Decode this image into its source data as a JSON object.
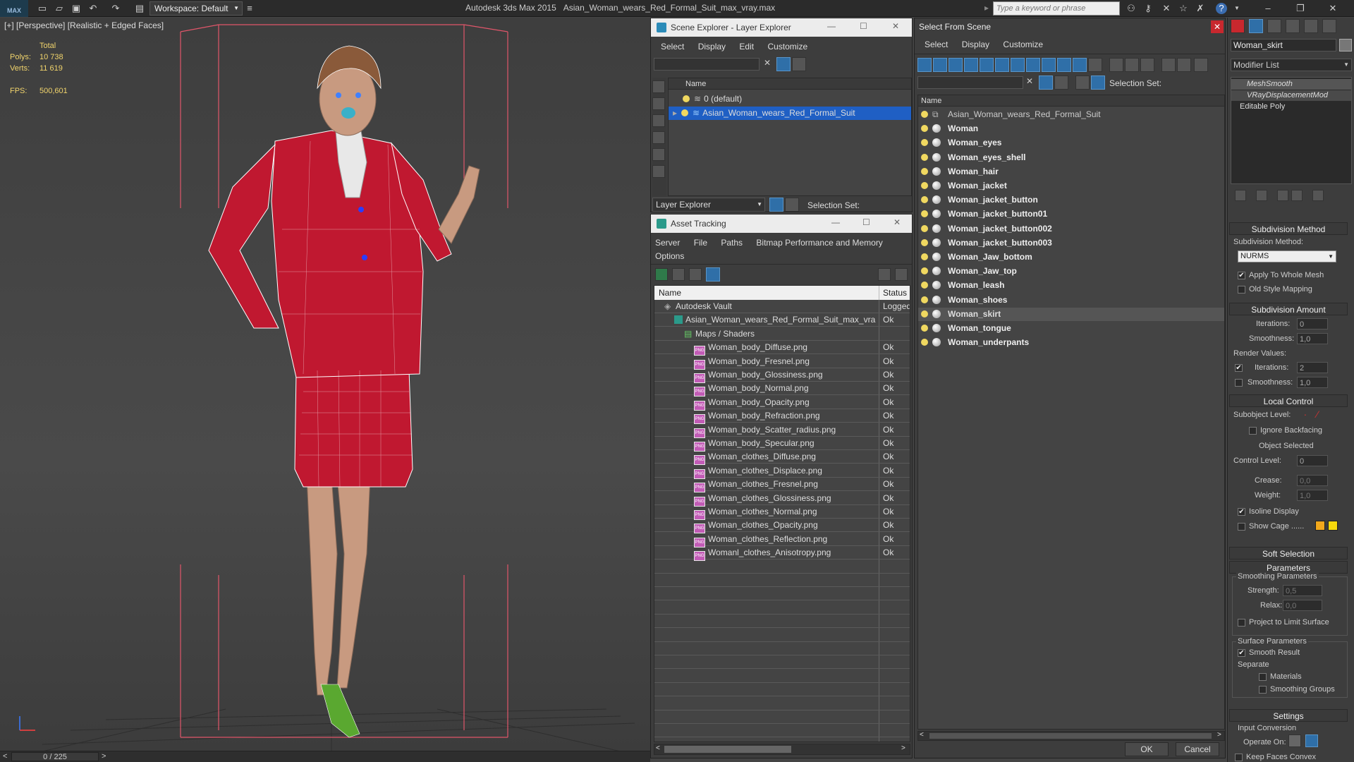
{
  "app": {
    "title": "Autodesk 3ds Max 2015",
    "file": "Asian_Woman_wears_Red_Formal_Suit_max_vray.max",
    "logo": "MAX",
    "workspace": "Workspace: Default",
    "search_placeholder": "Type a keyword or phrase"
  },
  "viewport": {
    "label": "[+] [Perspective] [Realistic + Edged Faces]",
    "stats_header": "Total",
    "polys_label": "Polys:",
    "polys": "10 738",
    "verts_label": "Verts:",
    "verts": "11 619",
    "fps_label": "FPS:",
    "fps": "500,601",
    "timeline": "0 / 225"
  },
  "scene_explorer": {
    "title": "Scene Explorer - Layer Explorer",
    "menu": [
      "Select",
      "Display",
      "Edit",
      "Customize"
    ],
    "column": "Name",
    "rows": [
      "0 (default)",
      "Asian_Woman_wears_Red_Formal_Suit"
    ],
    "footer_dropdown": "Layer Explorer",
    "selection_set": "Selection Set:"
  },
  "asset_tracking": {
    "title": "Asset Tracking",
    "menu": [
      "Server",
      "File",
      "Paths",
      "Bitmap Performance and Memory"
    ],
    "menu2": "Options",
    "col_name": "Name",
    "col_status": "Status",
    "rows": [
      {
        "name": "Autodesk Vault",
        "status": "Logged",
        "level": 0,
        "type": "vault"
      },
      {
        "name": "Asian_Woman_wears_Red_Formal_Suit_max_vra...",
        "status": "Ok",
        "level": 1,
        "type": "max"
      },
      {
        "name": "Maps / Shaders",
        "status": "",
        "level": 2,
        "type": "folder"
      },
      {
        "name": "Woman_body_Diffuse.png",
        "status": "Ok",
        "level": 3,
        "type": "png"
      },
      {
        "name": "Woman_body_Fresnel.png",
        "status": "Ok",
        "level": 3,
        "type": "png"
      },
      {
        "name": "Woman_body_Glossiness.png",
        "status": "Ok",
        "level": 3,
        "type": "png"
      },
      {
        "name": "Woman_body_Normal.png",
        "status": "Ok",
        "level": 3,
        "type": "png"
      },
      {
        "name": "Woman_body_Opacity.png",
        "status": "Ok",
        "level": 3,
        "type": "png"
      },
      {
        "name": "Woman_body_Refraction.png",
        "status": "Ok",
        "level": 3,
        "type": "png"
      },
      {
        "name": "Woman_body_Scatter_radius.png",
        "status": "Ok",
        "level": 3,
        "type": "png"
      },
      {
        "name": "Woman_body_Specular.png",
        "status": "Ok",
        "level": 3,
        "type": "png"
      },
      {
        "name": "Woman_clothes_Diffuse.png",
        "status": "Ok",
        "level": 3,
        "type": "png"
      },
      {
        "name": "Woman_clothes_Displace.png",
        "status": "Ok",
        "level": 3,
        "type": "png"
      },
      {
        "name": "Woman_clothes_Fresnel.png",
        "status": "Ok",
        "level": 3,
        "type": "png"
      },
      {
        "name": "Woman_clothes_Glossiness.png",
        "status": "Ok",
        "level": 3,
        "type": "png"
      },
      {
        "name": "Woman_clothes_Normal.png",
        "status": "Ok",
        "level": 3,
        "type": "png"
      },
      {
        "name": "Woman_clothes_Opacity.png",
        "status": "Ok",
        "level": 3,
        "type": "png"
      },
      {
        "name": "Woman_clothes_Reflection.png",
        "status": "Ok",
        "level": 3,
        "type": "png"
      },
      {
        "name": "Womanl_clothes_Anisotropy.png",
        "status": "Ok",
        "level": 3,
        "type": "png"
      }
    ]
  },
  "select_from_scene": {
    "title": "Select From Scene",
    "menu": [
      "Select",
      "Display",
      "Customize"
    ],
    "selection_set": "Selection Set:",
    "column": "Name",
    "rows": [
      {
        "name": "Asian_Woman_wears_Red_Formal_Suit",
        "group": true,
        "selected": false
      },
      {
        "name": "Woman",
        "group": false,
        "selected": false
      },
      {
        "name": "Woman_eyes",
        "group": false,
        "selected": false
      },
      {
        "name": "Woman_eyes_shell",
        "group": false,
        "selected": false
      },
      {
        "name": "Woman_hair",
        "group": false,
        "selected": false
      },
      {
        "name": "Woman_jacket",
        "group": false,
        "selected": false
      },
      {
        "name": "Woman_jacket_button",
        "group": false,
        "selected": false
      },
      {
        "name": "Woman_jacket_button01",
        "group": false,
        "selected": false
      },
      {
        "name": "Woman_jacket_button002",
        "group": false,
        "selected": false
      },
      {
        "name": "Woman_jacket_button003",
        "group": false,
        "selected": false
      },
      {
        "name": "Woman_Jaw_bottom",
        "group": false,
        "selected": false
      },
      {
        "name": "Woman_Jaw_top",
        "group": false,
        "selected": false
      },
      {
        "name": "Woman_leash",
        "group": false,
        "selected": false
      },
      {
        "name": "Woman_shoes",
        "group": false,
        "selected": false
      },
      {
        "name": "Woman_skirt",
        "group": false,
        "selected": true
      },
      {
        "name": "Woman_tongue",
        "group": false,
        "selected": false
      },
      {
        "name": "Woman_underpants",
        "group": false,
        "selected": false
      }
    ],
    "ok": "OK",
    "cancel": "Cancel"
  },
  "command_panel": {
    "object_name": "Woman_skirt",
    "modifier_list": "Modifier List",
    "stack": [
      "MeshSmooth",
      "VRayDisplacementMod",
      "Editable Poly"
    ],
    "subdivision_method": {
      "header": "Subdivision Method",
      "label": "Subdivision Method:",
      "value": "NURMS",
      "apply_whole_mesh": "Apply To Whole Mesh",
      "old_style_mapping": "Old Style Mapping"
    },
    "subdivision_amount": {
      "header": "Subdivision Amount",
      "iterations_label": "Iterations:",
      "iterations": "0",
      "smoothness_label": "Smoothness:",
      "smoothness": "1,0",
      "render_values": "Render Values:",
      "r_iterations_label": "Iterations:",
      "r_iterations": "2",
      "r_smoothness_label": "Smoothness:",
      "r_smoothness": "1,0"
    },
    "local_control": {
      "header": "Local Control",
      "subobject_label": "Subobject Level:",
      "ignore_backfacing": "Ignore Backfacing",
      "object_selected": "Object Selected",
      "control_level_label": "Control Level:",
      "control_level": "0",
      "crease_label": "Crease:",
      "crease": "0,0",
      "weight_label": "Weight:",
      "weight": "1,0",
      "isoline_display": "Isoline Display",
      "show_cage": "Show Cage ......"
    },
    "soft_selection": "Soft Selection",
    "parameters": {
      "header": "Parameters",
      "smoothing_params": "Smoothing Parameters",
      "strength_label": "Strength:",
      "strength": "0,5",
      "relax_label": "Relax:",
      "relax": "0,0",
      "project_limit": "Project to Limit Surface",
      "surface_params": "Surface Parameters",
      "smooth_result": "Smooth Result",
      "separate": "Separate",
      "materials": "Materials",
      "smoothing_groups": "Smoothing Groups"
    },
    "settings": {
      "header": "Settings",
      "input_conversion": "Input Conversion",
      "operate_on": "Operate On:",
      "keep_faces_convex": "Keep Faces Convex"
    }
  },
  "colors": {
    "accent": "#2f6fa8",
    "selected_row": "#1f5fc4",
    "wire": "#e0566a",
    "suit": "#c01830",
    "cage_a": "#f2a81c",
    "cage_b": "#f5d80c"
  }
}
